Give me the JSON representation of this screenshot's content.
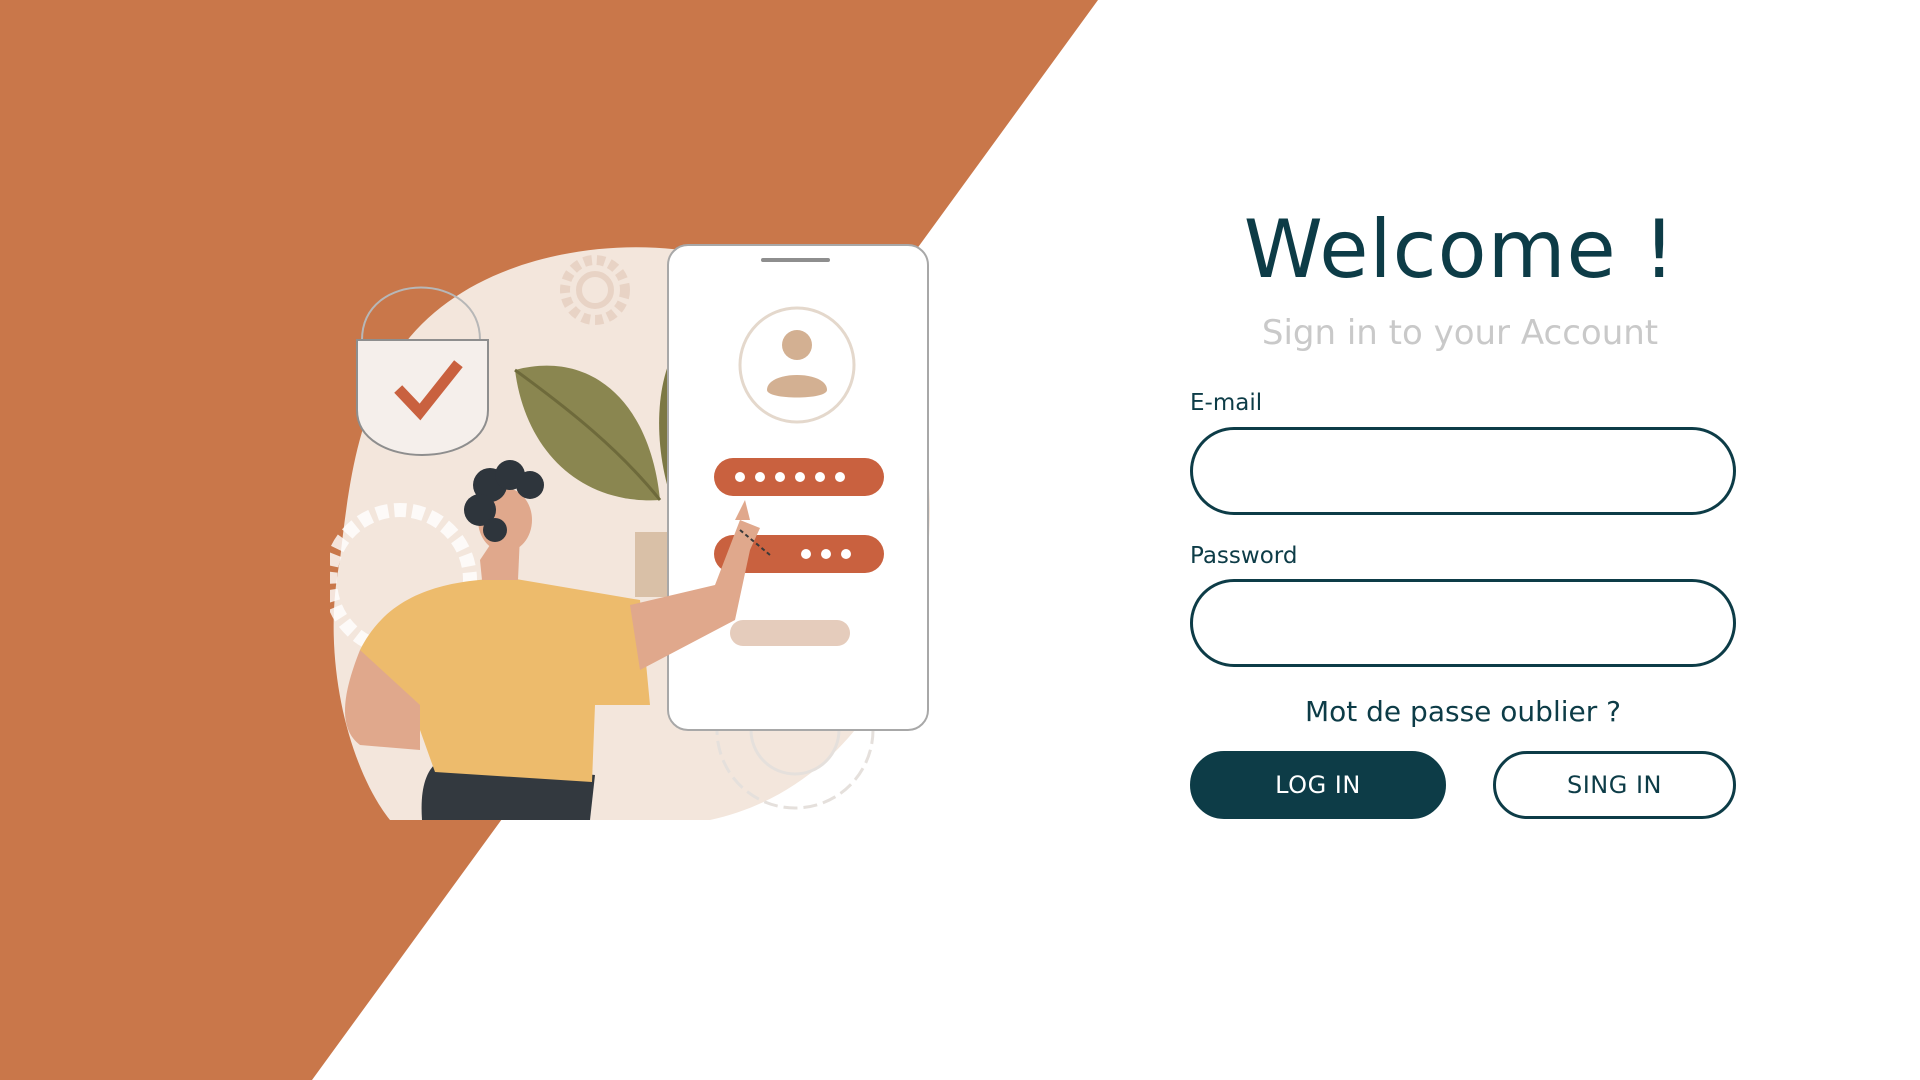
{
  "colors": {
    "accent_orange": "#c9774a",
    "primary_dark": "#0d3c47",
    "subtitle_gray": "#c9c9c9",
    "background": "#ffffff"
  },
  "header": {
    "title": "Welcome !",
    "subtitle": "Sign in to your Account"
  },
  "form": {
    "email_label": "E-mail",
    "email_value": "",
    "password_label": "Password",
    "password_value": "",
    "forgot_link": "Mot de passe oublier ?",
    "login_button": "LOG IN",
    "signin_button": "SING IN"
  },
  "illustration": {
    "icons": [
      "lock-icon",
      "check-icon",
      "gear-icon",
      "user-avatar-icon",
      "phone-icon",
      "leaf-icon",
      "person-icon"
    ]
  }
}
